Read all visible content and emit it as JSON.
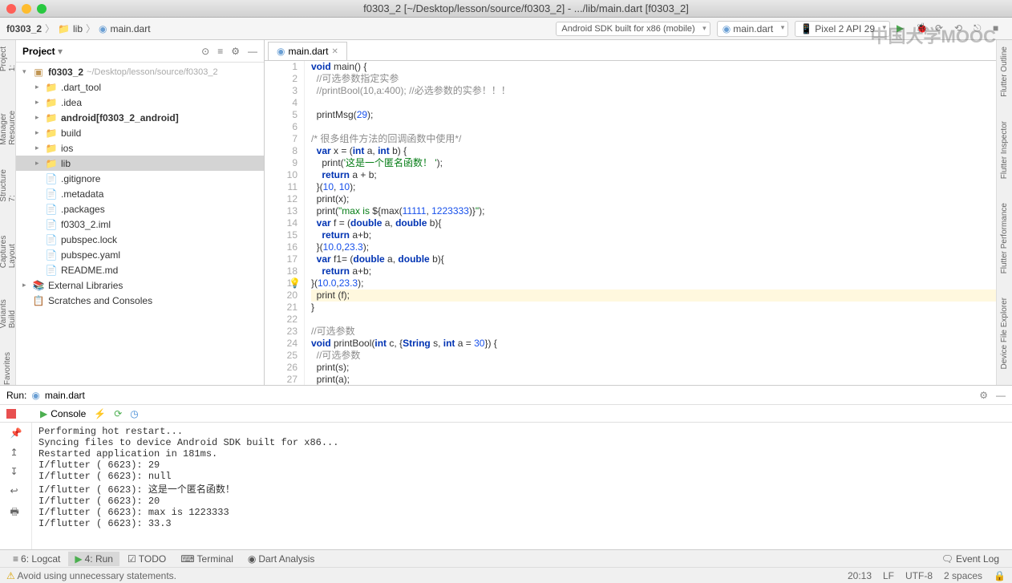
{
  "window": {
    "title": "f0303_2 [~/Desktop/lesson/source/f0303_2] - .../lib/main.dart [f0303_2]"
  },
  "breadcrumb": {
    "root": "f0303_2",
    "mid": "lib",
    "leaf": "main.dart"
  },
  "toolbar": {
    "device": "Android SDK built for x86 (mobile)",
    "config": "main.dart",
    "avd": "Pixel 2 API 29"
  },
  "project": {
    "panel_title": "Project",
    "root": {
      "name": "f0303_2",
      "hint": "~/Desktop/lesson/source/f0303_2"
    },
    "items": [
      {
        "label": ".dart_tool",
        "indent": 1,
        "arrow": "▸",
        "type": "folder"
      },
      {
        "label": ".idea",
        "indent": 1,
        "arrow": "▸",
        "type": "folder"
      },
      {
        "label": "android",
        "suffix": "[f0303_2_android]",
        "indent": 1,
        "arrow": "▸",
        "type": "folder",
        "bold": true
      },
      {
        "label": "build",
        "indent": 1,
        "arrow": "▸",
        "type": "folder"
      },
      {
        "label": "ios",
        "indent": 1,
        "arrow": "▸",
        "type": "folder"
      },
      {
        "label": "lib",
        "indent": 1,
        "arrow": "▸",
        "type": "folder",
        "selected": true
      },
      {
        "label": ".gitignore",
        "indent": 1,
        "arrow": "",
        "type": "file"
      },
      {
        "label": ".metadata",
        "indent": 1,
        "arrow": "",
        "type": "file"
      },
      {
        "label": ".packages",
        "indent": 1,
        "arrow": "",
        "type": "file"
      },
      {
        "label": "f0303_2.iml",
        "indent": 1,
        "arrow": "",
        "type": "file"
      },
      {
        "label": "pubspec.lock",
        "indent": 1,
        "arrow": "",
        "type": "file"
      },
      {
        "label": "pubspec.yaml",
        "indent": 1,
        "arrow": "",
        "type": "file"
      },
      {
        "label": "README.md",
        "indent": 1,
        "arrow": "",
        "type": "file"
      }
    ],
    "external": "External Libraries",
    "scratches": "Scratches and Consoles"
  },
  "editor": {
    "tab": "main.dart",
    "lines": [
      {
        "n": 1,
        "html": "<span class='kw'>void</span> main() {"
      },
      {
        "n": 2,
        "html": "  <span class='cmt'>//可选参数指定实参</span>"
      },
      {
        "n": 3,
        "html": "  <span class='cmt'>//printBool(10,a:400); //必选参数的实参！！！</span>"
      },
      {
        "n": 4,
        "html": ""
      },
      {
        "n": 5,
        "html": "  printMsg(<span class='num'>29</span>);"
      },
      {
        "n": 6,
        "html": ""
      },
      {
        "n": 7,
        "html": "<span class='cmt'>/* 很多组件方法的回调函数中使用*/</span>"
      },
      {
        "n": 8,
        "html": "  <span class='kw'>var</span> x = (<span class='kw'>int</span> a, <span class='kw'>int</span> b) {"
      },
      {
        "n": 9,
        "html": "    print(<span class='str'>'这是一个匿名函数！ '</span>);"
      },
      {
        "n": 10,
        "html": "    <span class='kw'>return</span> a + b;"
      },
      {
        "n": 11,
        "html": "  }(<span class='num'>10</span>, <span class='num'>10</span>);"
      },
      {
        "n": 12,
        "html": "  print(x);"
      },
      {
        "n": 13,
        "html": "  print(<span class='str'>\"max is </span>${max(<span class='num'>11111</span>, <span class='num'>1223333</span>)}<span class='str'>\"</span>);"
      },
      {
        "n": 14,
        "html": "  <span class='kw'>var</span> f = (<span class='kw'>double</span> a, <span class='kw'>double</span> b){"
      },
      {
        "n": 15,
        "html": "    <span class='kw'>return</span> a+b;"
      },
      {
        "n": 16,
        "html": "  }(<span class='num'>10.0</span>,<span class='num'>23.3</span>);"
      },
      {
        "n": 17,
        "html": "  <span class='kw'>var</span> f1= (<span class='kw'>double</span> a, <span class='kw'>double</span> b){"
      },
      {
        "n": 18,
        "html": "    <span class='kw'>return</span> a+b;"
      },
      {
        "n": 19,
        "html": "<span class='bulb'>💡</span>}(<span class='num'>10.0</span>,<span class='num'>23.3</span>);"
      },
      {
        "n": 20,
        "html": "  print (f);",
        "hl": true
      },
      {
        "n": 21,
        "html": "}"
      },
      {
        "n": 22,
        "html": ""
      },
      {
        "n": 23,
        "html": "<span class='cmt'>//可选参数</span>"
      },
      {
        "n": 24,
        "html": "<span class='kw'>void</span> printBool(<span class='kw'>int</span> c, {<span class='kw'>String</span> s, <span class='kw'>int</span> a = <span class='num'>30</span>}) {"
      },
      {
        "n": 25,
        "html": "  <span class='cmt'>//可选参数</span>"
      },
      {
        "n": 26,
        "html": "  print(s);"
      },
      {
        "n": 27,
        "html": "  print(a);"
      }
    ]
  },
  "run": {
    "title": "Run:",
    "config": "main.dart",
    "console_label": "Console",
    "output": "Performing hot restart...\nSyncing files to device Android SDK built for x86...\nRestarted application in 181ms.\nI/flutter ( 6623): 29\nI/flutter ( 6623): null\nI/flutter ( 6623): 这是一个匿名函数！\nI/flutter ( 6623): 20\nI/flutter ( 6623): max is 1223333\nI/flutter ( 6623): 33.3"
  },
  "bottom_tabs": {
    "logcat": "6: Logcat",
    "run": "4: Run",
    "todo": "TODO",
    "terminal": "Terminal",
    "dart": "Dart Analysis",
    "event_log": "Event Log"
  },
  "status": {
    "message": "Avoid using unnecessary statements.",
    "pos": "20:13",
    "le": "LF",
    "enc": "UTF-8",
    "ind": "2 spaces"
  },
  "rails": {
    "left": [
      "1: Project",
      "Resource Manager",
      "7: Structure",
      "Layout Captures",
      "Build Variants",
      "Favorites"
    ],
    "right": [
      "Flutter Outline",
      "Flutter Inspector",
      "Flutter Performance",
      "Device File Explorer"
    ]
  },
  "watermark": "中国大学MOOC"
}
